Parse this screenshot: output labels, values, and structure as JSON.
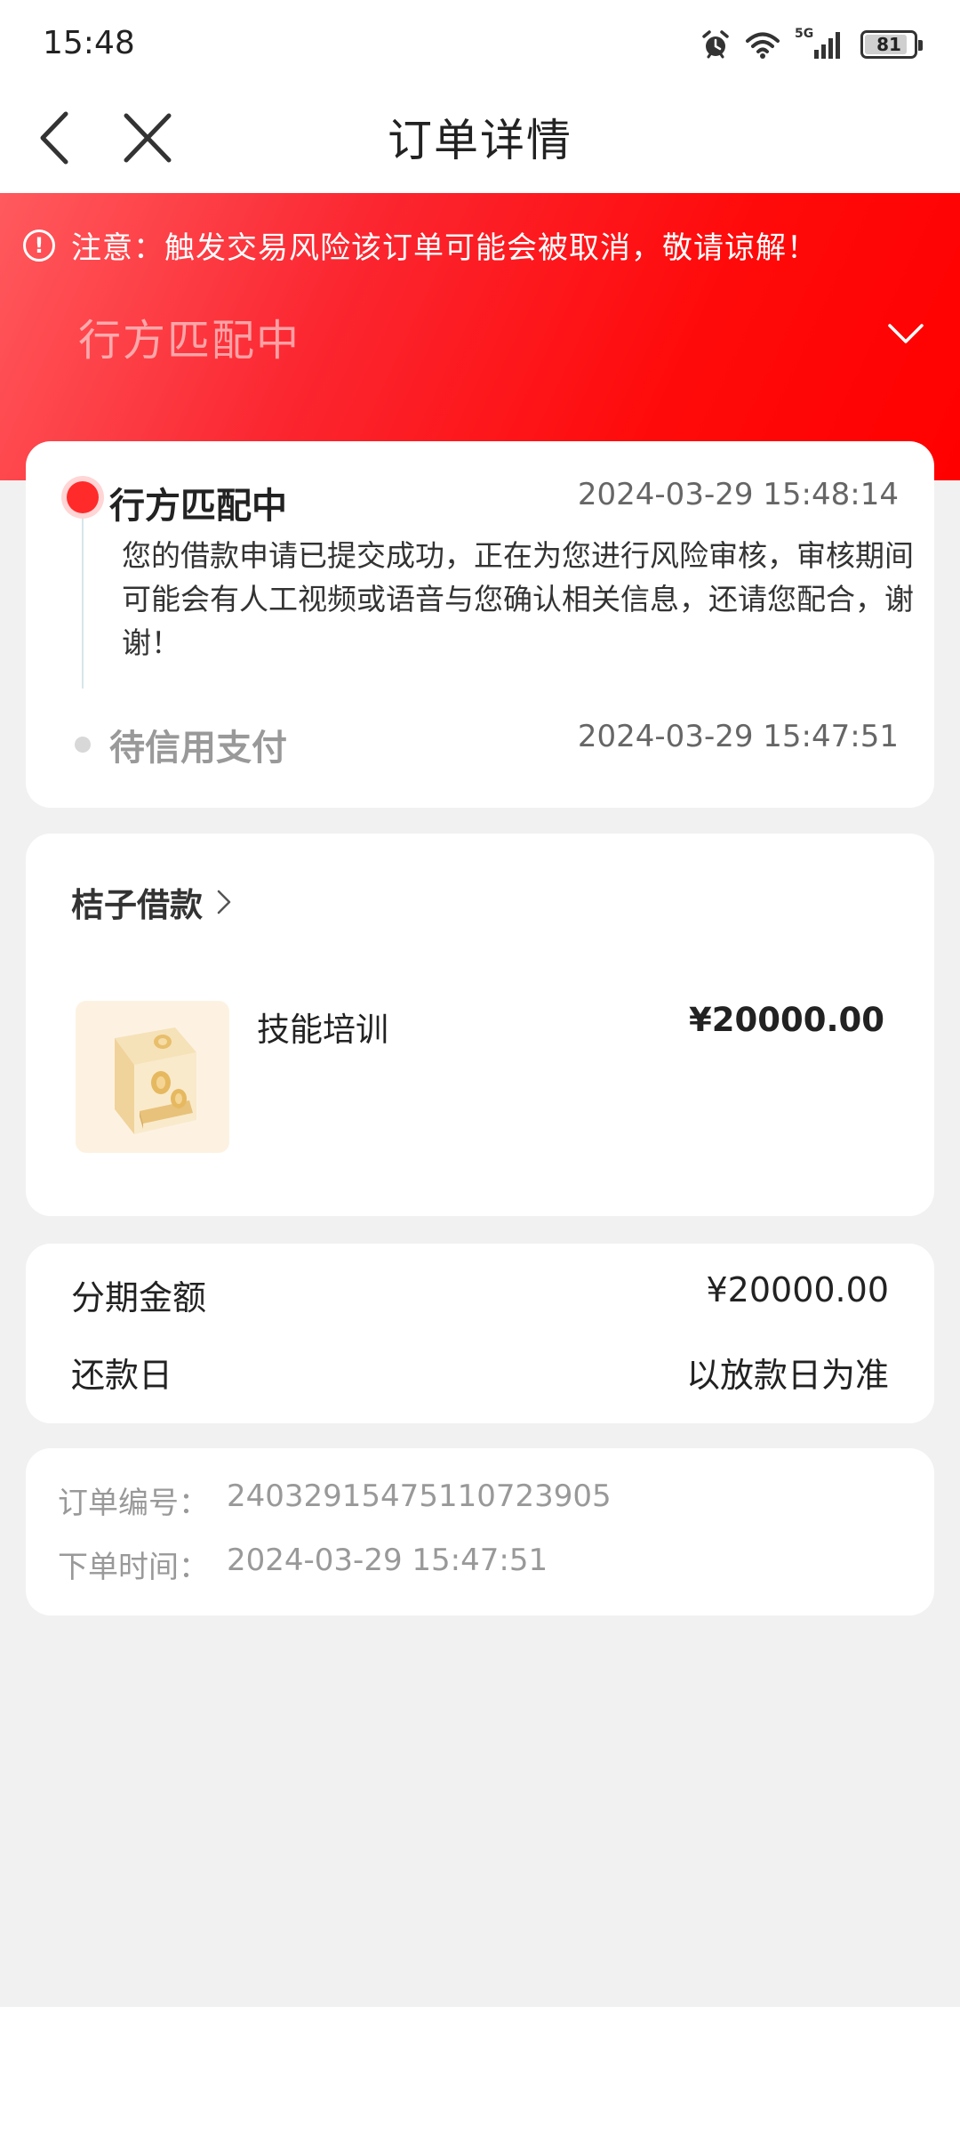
{
  "status_bar": {
    "time": "15:48",
    "network": "5G",
    "battery": "81"
  },
  "nav": {
    "title": "订单详情",
    "back_icon": "chevron-left-icon",
    "close_icon": "close-icon"
  },
  "banner": {
    "warning": "注意：触发交易风险该订单可能会被取消，敬请谅解！",
    "status": "行方匹配中",
    "colors": {
      "from": "#ff5a5e",
      "to": "#ff0000"
    }
  },
  "timeline": [
    {
      "title": "行方匹配中",
      "time": "2024-03-29 15:48:14",
      "description": "您的借款申请已提交成功，正在为您进行风险审核，审核期间可能会有人工视频或语音与您确认相关信息，还请您配合，谢谢！",
      "active": true
    },
    {
      "title": "待信用支付",
      "time": "2024-03-29 15:47:51",
      "active": false
    }
  ],
  "product": {
    "merchant": "桔子借款",
    "name": "技能培训",
    "price": "¥20000.00"
  },
  "amounts": {
    "installment_label": "分期金额",
    "installment_value": "¥20000.00",
    "repay_label": "还款日",
    "repay_value": "以放款日为准"
  },
  "order": {
    "number_label": "订单编号：",
    "number_value": "24032915475110723905",
    "time_label": "下单时间：",
    "time_value": "2024-03-29 15:47:51"
  }
}
